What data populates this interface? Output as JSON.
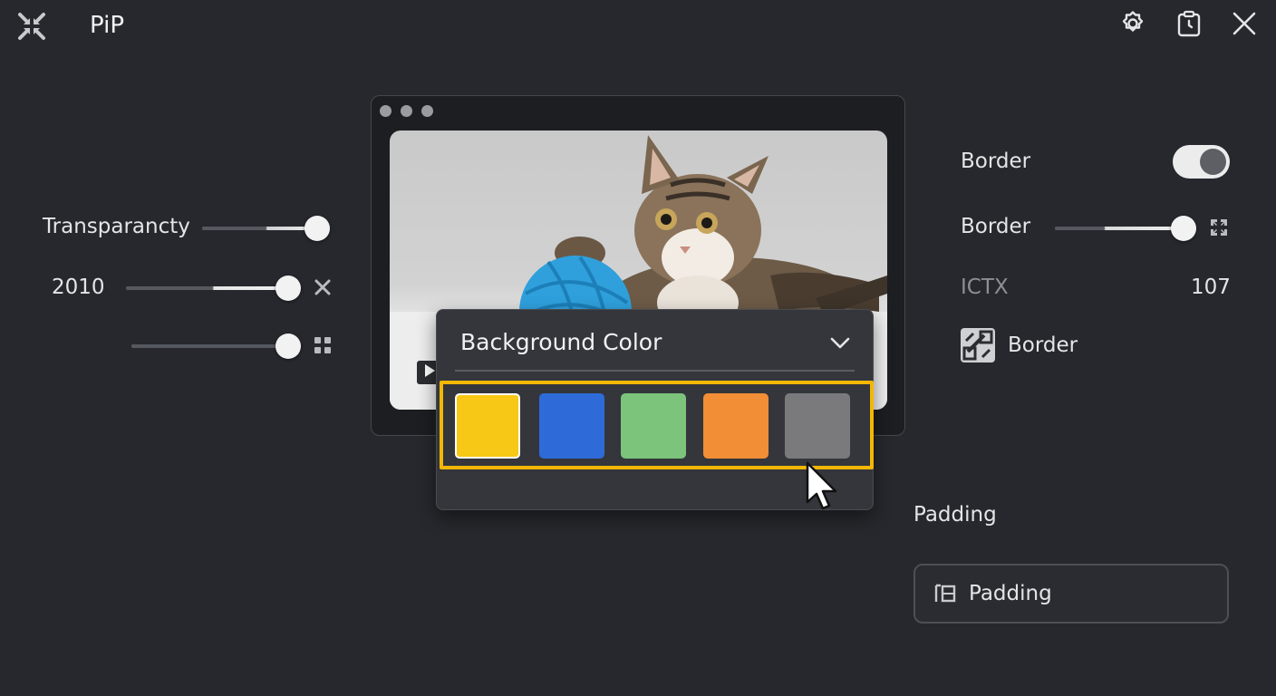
{
  "header": {
    "app_title": "PiP",
    "logo_icon": "collapse-arrows-icon",
    "actions": [
      {
        "name": "settings",
        "icon": "gear-icon"
      },
      {
        "name": "history",
        "icon": "clipboard-clock-icon"
      },
      {
        "name": "close",
        "icon": "close-icon"
      }
    ]
  },
  "left_panel": {
    "transparency": {
      "label": "Transparancty",
      "value_fraction": 1.0
    },
    "value_slider": {
      "label": "2010",
      "value_fraction": 1.0,
      "action_icon": "x-icon"
    },
    "third_slider": {
      "value_fraction": 1.0,
      "action_icon": "grid-icon"
    }
  },
  "preview": {
    "subject": "kitten with blue yarn ball",
    "play_icon": "play-icon"
  },
  "dropdown": {
    "title": "Background Color",
    "chevron_icon": "chevron-down-icon",
    "highlight_color": "#f2b705",
    "swatches": [
      {
        "name": "yellow",
        "color": "#f7c815",
        "selected": true
      },
      {
        "name": "blue",
        "color": "#2e6bd9"
      },
      {
        "name": "green",
        "color": "#7cc47c"
      },
      {
        "name": "orange",
        "color": "#f28e35"
      },
      {
        "name": "gray",
        "color": "#7a7a7c"
      }
    ]
  },
  "right_panel": {
    "border_toggle": {
      "label": "Border",
      "on": true
    },
    "border_slider": {
      "label": "Border",
      "value_fraction": 1.0,
      "action_icon": "expand-icon"
    },
    "ictx": {
      "label": "ICTX",
      "value": "107"
    },
    "border_style": {
      "label": "Border",
      "icon": "border-style-icon"
    },
    "padding": {
      "section_label": "Padding",
      "button_label": "Padding",
      "icon": "padding-icon"
    }
  }
}
